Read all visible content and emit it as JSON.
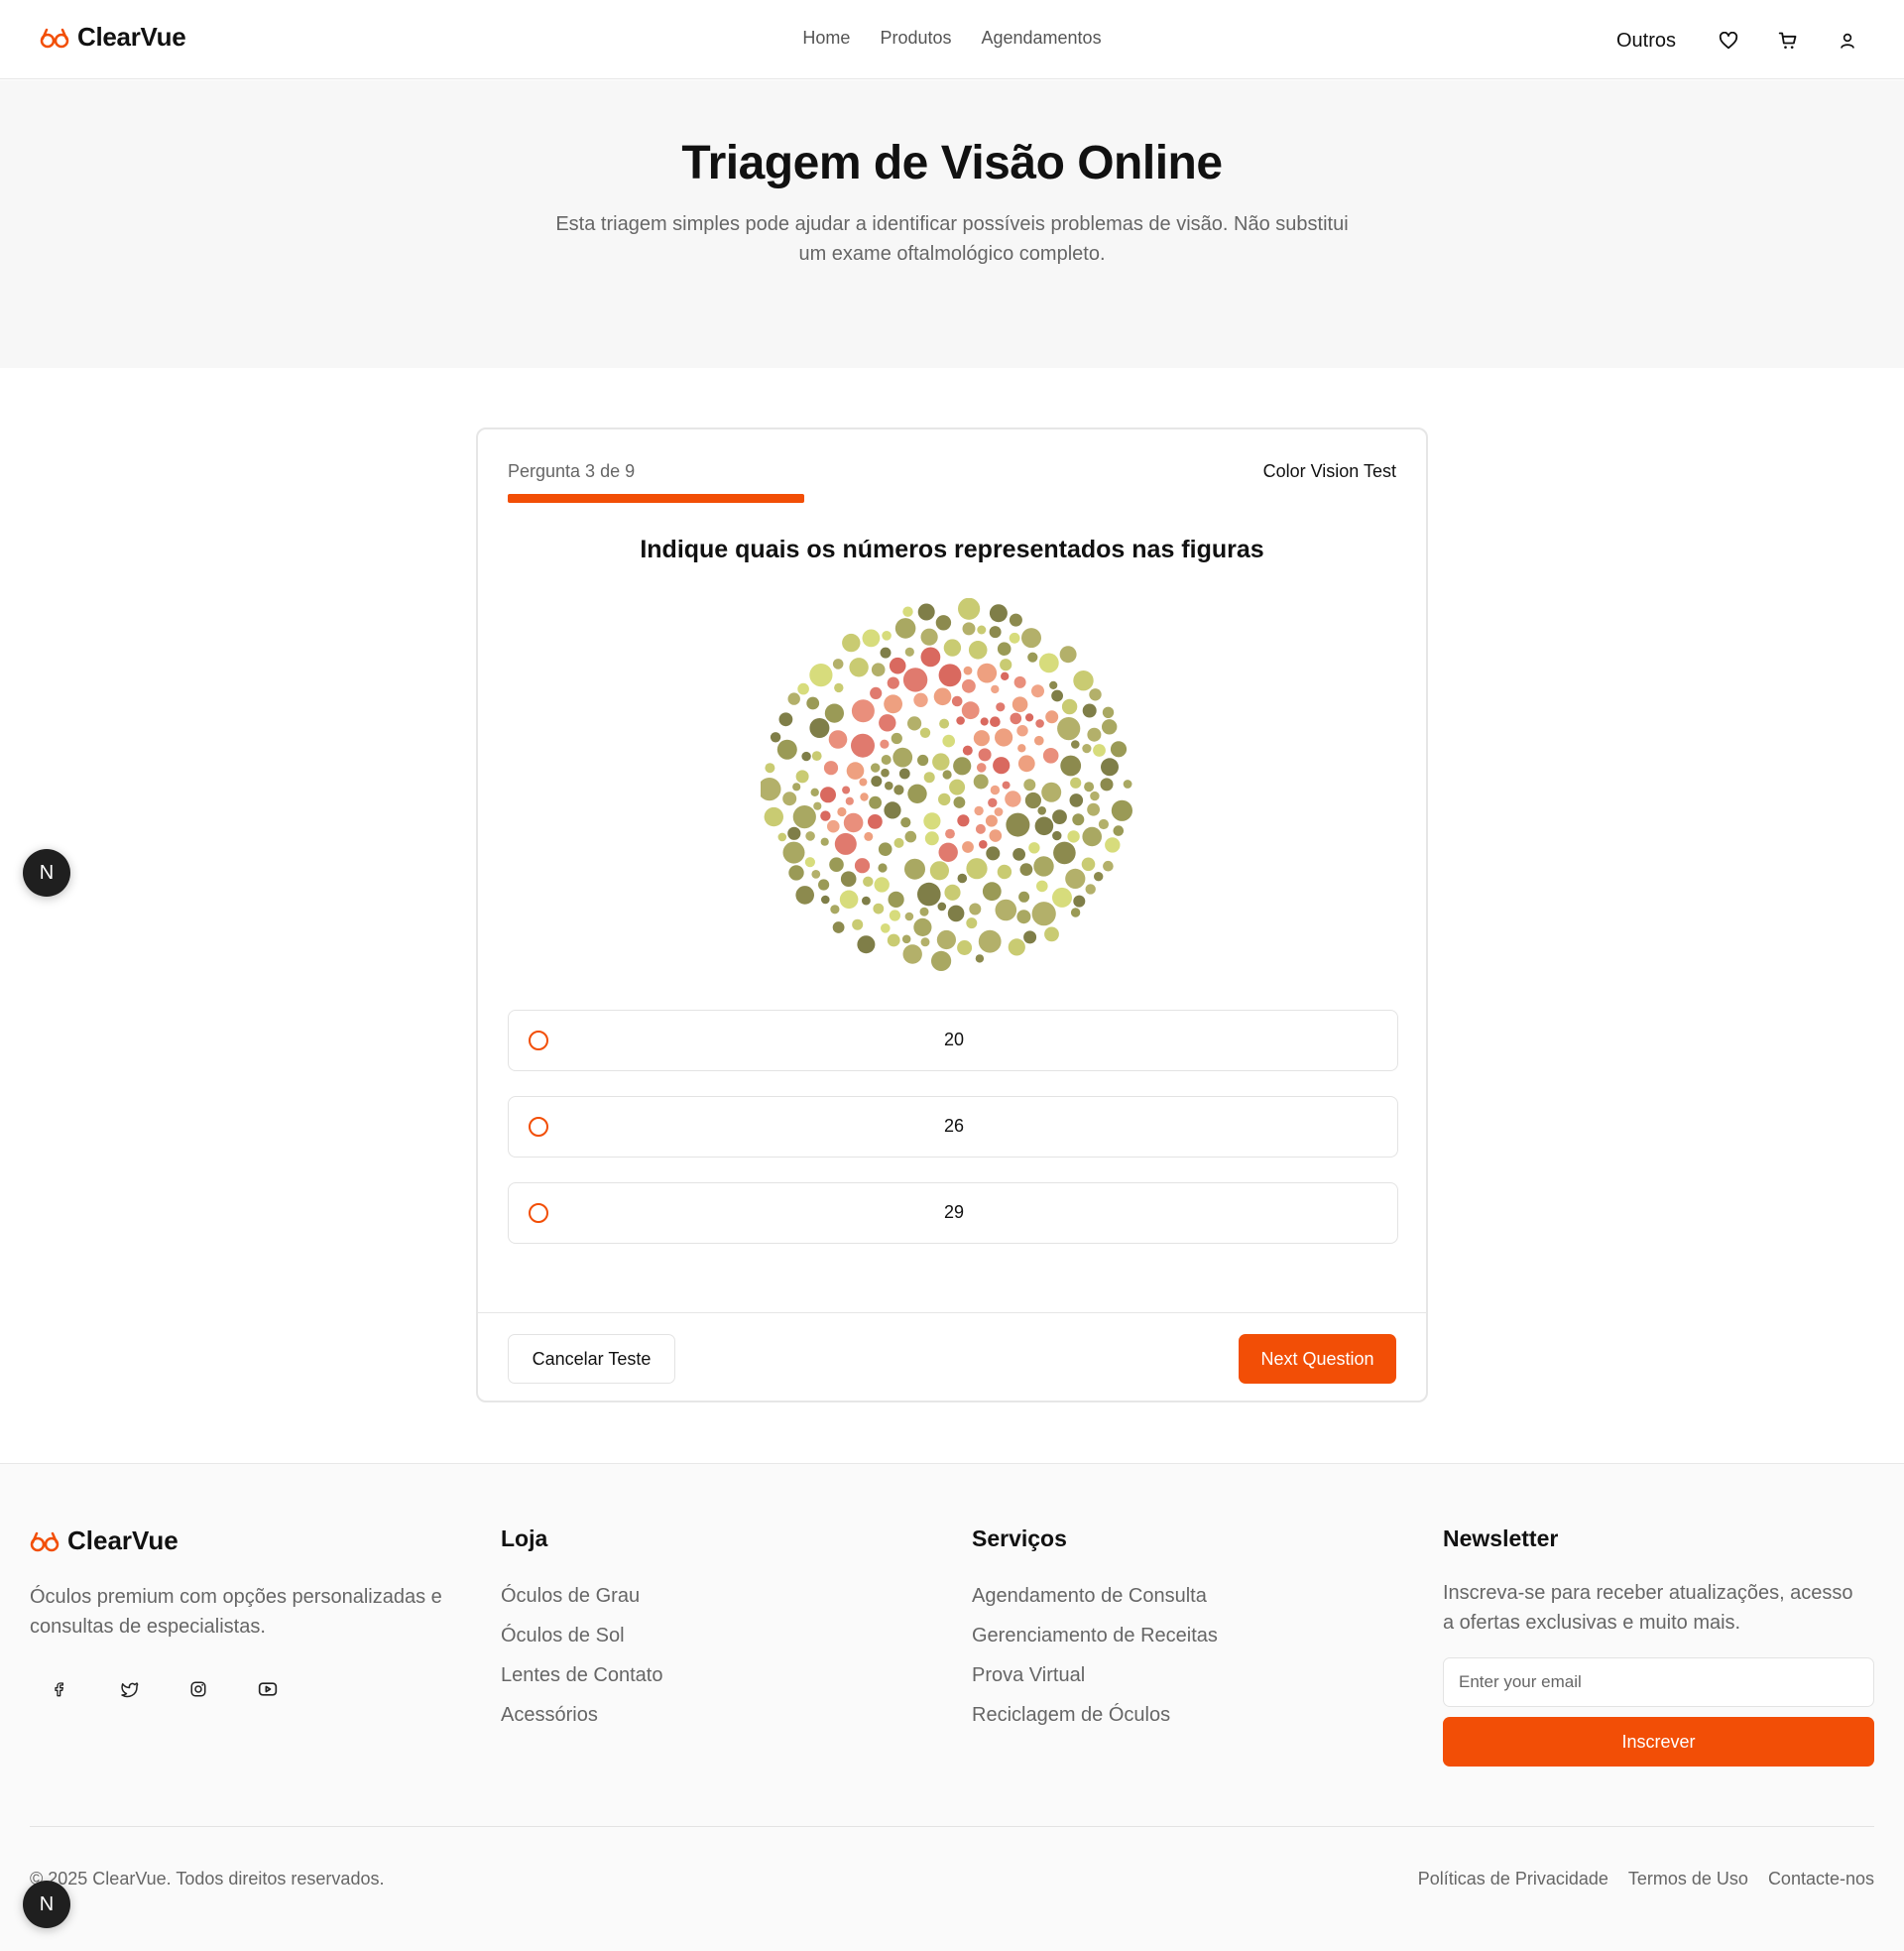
{
  "brand": {
    "name": "ClearVue",
    "accent_color": "#f24e06"
  },
  "nav": {
    "items": [
      "Home",
      "Produtos",
      "Agendamentos"
    ]
  },
  "header_right": {
    "outros_label": "Outros",
    "icons": [
      "heart-icon",
      "cart-icon",
      "user-icon"
    ]
  },
  "hero": {
    "title": "Triagem de Visão Online",
    "subtitle": "Esta triagem simples pode ajudar a identificar possíveis problemas de visão. Não substitui um exame oftalmológico completo."
  },
  "quiz": {
    "question_count": "Pergunta 3 de 9",
    "test_type": "Color Vision Test",
    "progress": 0.333,
    "question": "Indique quais os números representados nas figuras",
    "options": [
      "20",
      "26",
      "29"
    ],
    "cancel_label": "Cancelar Teste",
    "next_label": "Next Question"
  },
  "badge": {
    "letter": "N"
  },
  "footer": {
    "brand_name": "ClearVue",
    "description": "Óculos premium com opções personalizadas e consultas de especialistas.",
    "social_icons": [
      "facebook-icon",
      "twitter-icon",
      "instagram-icon",
      "youtube-icon"
    ],
    "store": {
      "heading": "Loja",
      "links": [
        "Óculos de Grau",
        "Óculos de Sol",
        "Lentes de Contato",
        "Acessórios"
      ]
    },
    "services": {
      "heading": "Serviços",
      "links": [
        "Agendamento de Consulta",
        "Gerenciamento de Receitas",
        "Prova Virtual",
        "Reciclagem de Óculos"
      ]
    },
    "newsletter": {
      "heading": "Newsletter",
      "description": "Inscreva-se para receber atualizações, acesso a ofertas exclusivas e muito mais.",
      "email_placeholder": "Enter your email",
      "subscribe_label": "Inscrever"
    },
    "copyright": "© 2025 ClearVue. Todos direitos reservados.",
    "legal_links": [
      "Políticas de Privacidade",
      "Termos de Uso",
      "Contacte-nos"
    ]
  }
}
